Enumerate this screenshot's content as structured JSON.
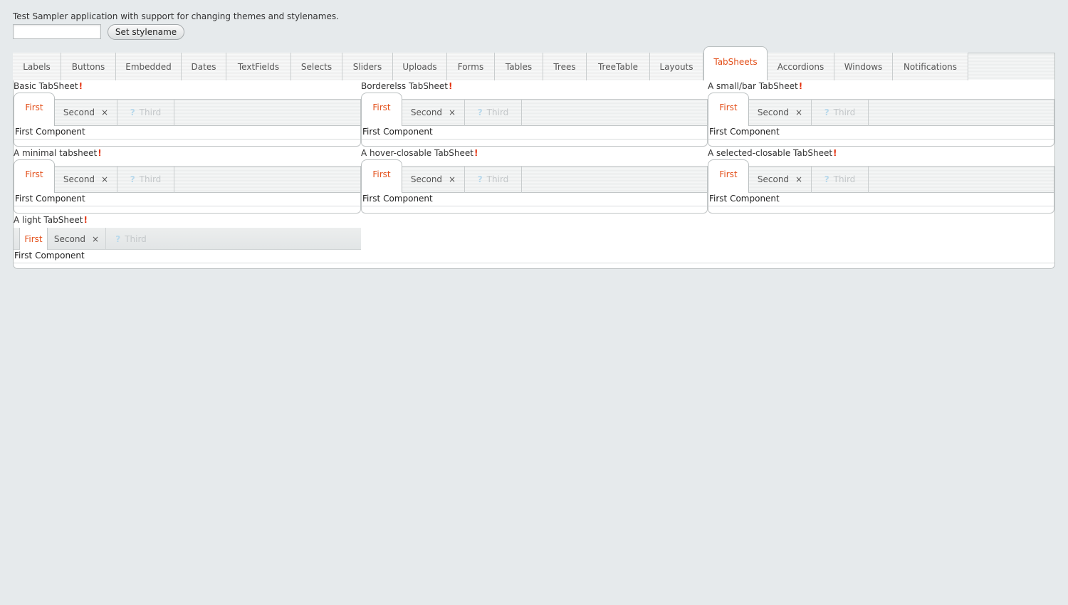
{
  "header": {
    "description": "Test Sampler application with support for changing themes and stylenames.",
    "stylename_input": {
      "value": "",
      "placeholder": ""
    },
    "set_button": "Set stylename"
  },
  "main_tabs": [
    "Labels",
    "Buttons",
    "Embedded",
    "Dates",
    "TextFields",
    "Selects",
    "Sliders",
    "Uploads",
    "Forms",
    "Tables",
    "Trees",
    "TreeTable",
    "Layouts",
    "TabSheets",
    "Accordions",
    "Windows",
    "Notifications"
  ],
  "selected_main_tab": "TabSheets",
  "sheets": [
    {
      "title": "Basic TabSheet",
      "marker": "!",
      "tabs": [
        "First",
        "Second",
        "Third"
      ],
      "close_glyph": "×",
      "help_glyph": "?",
      "content": "First Component"
    },
    {
      "title": "Borderelss TabSheet",
      "marker": "!",
      "tabs": [
        "First",
        "Second",
        "Third"
      ],
      "close_glyph": "×",
      "help_glyph": "?",
      "content": "First Component"
    },
    {
      "title": "A small/bar TabSheet",
      "marker": "!",
      "tabs": [
        "First",
        "Second",
        "Third"
      ],
      "close_glyph": "×",
      "help_glyph": "?",
      "content": "First Component"
    },
    {
      "title": "A minimal tabsheet",
      "marker": "!",
      "tabs": [
        "First",
        "Second",
        "Third"
      ],
      "close_glyph": "×",
      "help_glyph": "?",
      "content": "First Component"
    },
    {
      "title": "A hover-closable TabSheet",
      "marker": "!",
      "tabs": [
        "First",
        "Second",
        "Third"
      ],
      "close_glyph": "×",
      "help_glyph": "?",
      "content": "First Component"
    },
    {
      "title": "A selected-closable TabSheet",
      "marker": "!",
      "tabs": [
        "First",
        "Second",
        "Third"
      ],
      "close_glyph": "×",
      "help_glyph": "?",
      "content": "First Component"
    },
    {
      "title": "A light TabSheet",
      "marker": "!",
      "tabs": [
        "First",
        "Second",
        "Third"
      ],
      "close_glyph": "×",
      "help_glyph": "?",
      "content": "First Component"
    }
  ],
  "colors": {
    "accent": "#e3501b",
    "background": "#e6eaec",
    "error_marker": "#e3300d",
    "disabled_text": "#c3c7c9"
  }
}
